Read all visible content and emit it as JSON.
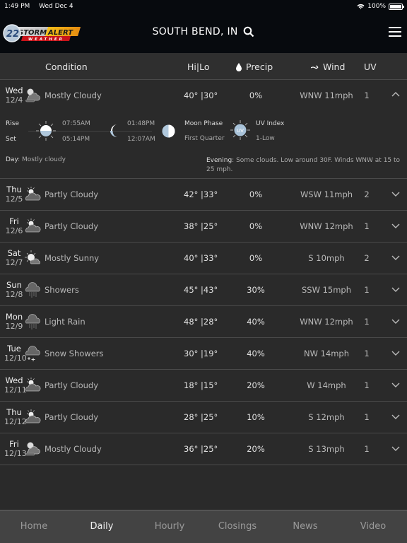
{
  "status_bar": {
    "time": "1:49 PM",
    "date": "Wed Dec 4",
    "battery": "100%"
  },
  "header": {
    "logo": {
      "number": "22",
      "line1a": "STORM",
      "line1b": "ALERT",
      "line2": "WEATHER"
    },
    "location": "SOUTH BEND, IN"
  },
  "columns": {
    "condition": "Condition",
    "hilo": "Hi|Lo",
    "precip": "Precip",
    "wind": "Wind",
    "uv": "UV"
  },
  "days": [
    {
      "day": "Wed",
      "date": "12/4",
      "icon": "mostly-cloudy",
      "condition": "Mostly Cloudy",
      "hilo": "40° |30°",
      "precip": "0%",
      "wind": "WNW 11mph",
      "uv": "1",
      "expanded": true
    },
    {
      "day": "Thu",
      "date": "12/5",
      "icon": "partly-cloudy",
      "condition": "Partly Cloudy",
      "hilo": "42° |33°",
      "precip": "0%",
      "wind": "WSW 11mph",
      "uv": "2"
    },
    {
      "day": "Fri",
      "date": "12/6",
      "icon": "partly-cloudy",
      "condition": "Partly Cloudy",
      "hilo": "38° |25°",
      "precip": "0%",
      "wind": "WNW 12mph",
      "uv": "1"
    },
    {
      "day": "Sat",
      "date": "12/7",
      "icon": "mostly-sunny",
      "condition": "Mostly Sunny",
      "hilo": "40° |33°",
      "precip": "0%",
      "wind": "S 10mph",
      "uv": "2"
    },
    {
      "day": "Sun",
      "date": "12/8",
      "icon": "showers",
      "condition": "Showers",
      "hilo": "45° |43°",
      "precip": "30%",
      "wind": "SSW 15mph",
      "uv": "1"
    },
    {
      "day": "Mon",
      "date": "12/9",
      "icon": "rain",
      "condition": "Light Rain",
      "hilo": "48° |28°",
      "precip": "40%",
      "wind": "WNW 12mph",
      "uv": "1"
    },
    {
      "day": "Tue",
      "date": "12/10",
      "icon": "snow-showers",
      "condition": "Snow Showers",
      "hilo": "30° |19°",
      "precip": "40%",
      "wind": "NW 14mph",
      "uv": "1"
    },
    {
      "day": "Wed",
      "date": "12/11",
      "icon": "partly-cloudy",
      "condition": "Partly Cloudy",
      "hilo": "18° |15°",
      "precip": "20%",
      "wind": "W 14mph",
      "uv": "1"
    },
    {
      "day": "Thu",
      "date": "12/12",
      "icon": "partly-cloudy",
      "condition": "Partly Cloudy",
      "hilo": "28° |25°",
      "precip": "10%",
      "wind": "S 12mph",
      "uv": "1"
    },
    {
      "day": "Fri",
      "date": "12/13",
      "icon": "mostly-cloudy",
      "condition": "Mostly Cloudy",
      "hilo": "36° |25°",
      "precip": "20%",
      "wind": "S 13mph",
      "uv": "1"
    }
  ],
  "detail": {
    "rise_label": "Rise",
    "set_label": "Set",
    "sunrise": "07:55AM",
    "sunset": "05:14PM",
    "moonrise": "01:48PM",
    "moonset": "12:07AM",
    "moon_phase_label": "Moon Phase",
    "moon_phase": "First Quarter",
    "uv_label": "UV Index",
    "uv_value": "1-Low",
    "uv_badge": "UV",
    "day_label": "Day",
    "day_text": ": Mostly cloudy",
    "evening_label": "Evening",
    "evening_text": ": Some clouds. Low around 30F. Winds WNW at 15 to 25 mph."
  },
  "tabs": [
    {
      "label": "Home",
      "active": false
    },
    {
      "label": "Daily",
      "active": true
    },
    {
      "label": "Hourly",
      "active": false
    },
    {
      "label": "Closings",
      "active": false
    },
    {
      "label": "News",
      "active": false
    },
    {
      "label": "Video",
      "active": false
    }
  ]
}
